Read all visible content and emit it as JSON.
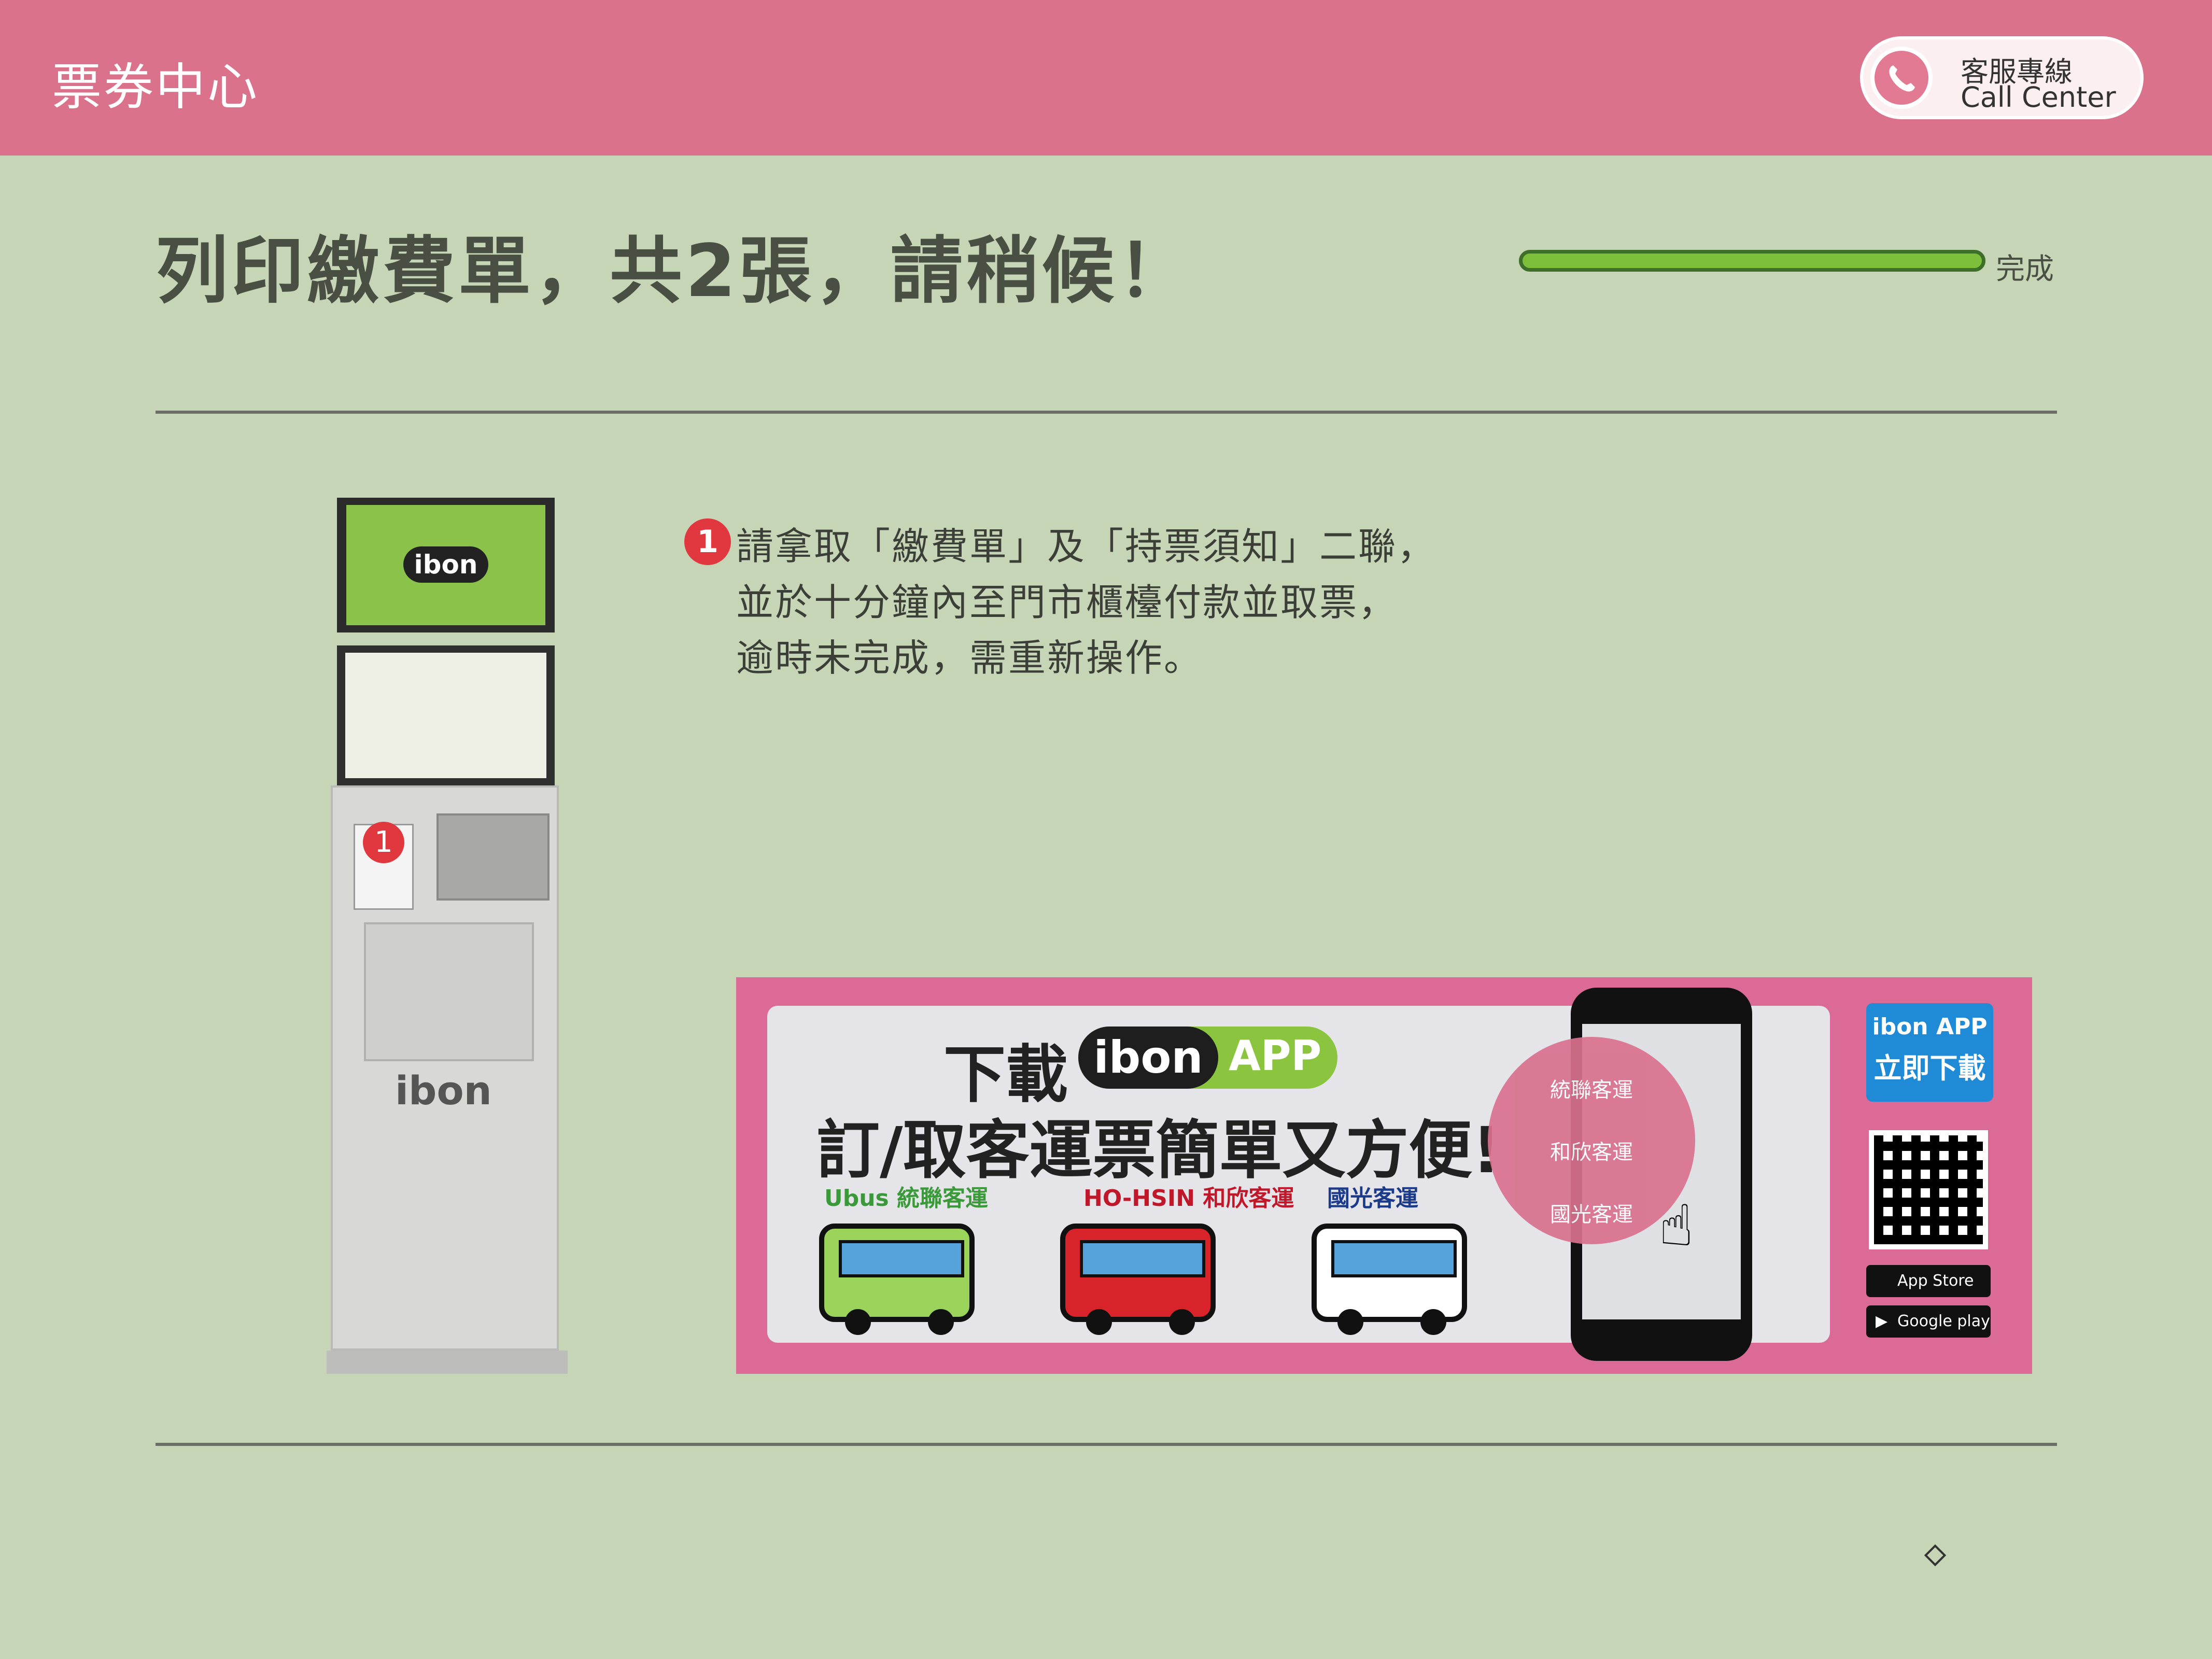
{
  "header": {
    "app_title": "票券中心",
    "call_center_zh": "客服專線",
    "call_center_en": "Call Center"
  },
  "main": {
    "title": "列印繳費單，共2張，請稍候！",
    "progress_label": "完成",
    "progress_value": 1.0,
    "step_number": "1",
    "instructions": [
      "請拿取「繳費單」及「持票須知」二聯，",
      "並於十分鐘內至門市櫃檯付款並取票，",
      "逾時未完成，需重新操作。"
    ]
  },
  "kiosk": {
    "badge": "1",
    "screen_logo": "ibon",
    "brand": "ibon"
  },
  "banner": {
    "line1_prefix": "下載",
    "ibon_logo": "ibon",
    "app_label": "APP",
    "line2": "訂/取客運票簡單又方便!",
    "operators": [
      "Ubus 統聯客運",
      "HO-HSIN 和欣客運",
      "國光客運"
    ],
    "circle_options": [
      "統聯客運",
      "和欣客運",
      "國光客運"
    ],
    "download_title1": "ibon APP",
    "download_title2": "立即下載",
    "app_store": "App Store",
    "google_play": "Google play"
  },
  "colors": {
    "header": "#d9728a",
    "background": "#c6d5b6",
    "progress": "#7dbe3a",
    "badge": "#e0383e",
    "banner": "#db6a97"
  },
  "icons": [
    "phone-icon",
    "step-badge-icon",
    "bus-icon",
    "qr-code-icon",
    "apple-icon",
    "google-play-icon",
    "hand-pointer-icon"
  ]
}
